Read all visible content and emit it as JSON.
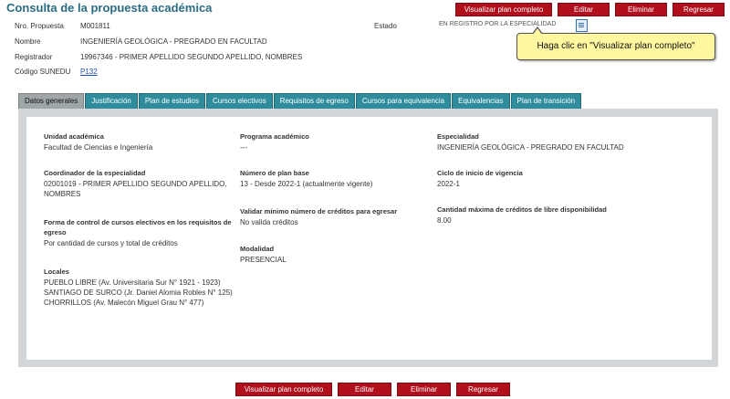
{
  "page": {
    "title": "Consulta de la propuesta académica"
  },
  "actions": {
    "view_plan": "Visualizar plan completo",
    "edit": "Editar",
    "delete": "Eliminar",
    "back": "Regresar"
  },
  "header": {
    "nro_label": "Nro. Propuesta",
    "nro_value": "M001811",
    "nombre_label": "Nombre",
    "nombre_value": "INGENIERÍA GEOLÓGICA - PREGRADO EN FACULTAD",
    "registrador_label": "Registrador",
    "registrador_value": "19967346 - PRIMER APELLIDO SEGUNDO APELLIDO, NOMBRES",
    "sunedu_label": "Código SUNEDU",
    "sunedu_value": "P132",
    "estado_label": "Estado",
    "estado_value": "EN REGISTRO POR LA ESPECIALIDAD"
  },
  "tooltip": {
    "text": "Haga clic en \"Visualizar plan completo\""
  },
  "tabs": [
    {
      "label": "Datos generales",
      "active": true
    },
    {
      "label": "Justificación"
    },
    {
      "label": "Plan de estudios"
    },
    {
      "label": "Cursos electivos"
    },
    {
      "label": "Requisitos de egreso"
    },
    {
      "label": "Cursos para equivalencia"
    },
    {
      "label": "Equivalencias"
    },
    {
      "label": "Plan de transición"
    }
  ],
  "general": {
    "unidad_label": "Unidad académica",
    "unidad_value": "Facultad de Ciencias e Ingeniería",
    "programa_label": "Programa académico",
    "programa_value": "---",
    "especialidad_label": "Especialidad",
    "especialidad_value": "INGENIERÍA GEOLÓGICA - PREGRADO EN FACULTAD",
    "coordinador_label": "Coordinador de la especialidad",
    "coordinador_value": "02001019 - PRIMER APELLIDO SEGUNDO APELLIDO, NOMBRES",
    "plan_base_label": "Número de plan base",
    "plan_base_value": "13 - Desde 2022-1 (actualmente vigente)",
    "ciclo_label": "Ciclo de inicio de vigencia",
    "ciclo_value": "2022-1",
    "validar_label": "Validar mínimo número de créditos para egresar",
    "validar_value": "No valida créditos",
    "cantidad_label": "Cantidad máxima de créditos de libre disponibilidad",
    "cantidad_value": "8.00",
    "forma_label": "Forma de control de cursos electivos en los requisitos de egreso",
    "forma_value": "Por cantidad de cursos y total de créditos",
    "modalidad_label": "Modalidad",
    "modalidad_value": "PRESENCIAL",
    "locales_label": "Locales",
    "locales": [
      "PUEBLO LIBRE (Av. Universitaria Sur N° 1921 - 1923)",
      "SANTIAGO DE SURCO (Jr. Daniel Alomia Robles N° 125)",
      "CHORRILLOS (Av. Malecón Miguel Grau N° 477)"
    ]
  }
}
